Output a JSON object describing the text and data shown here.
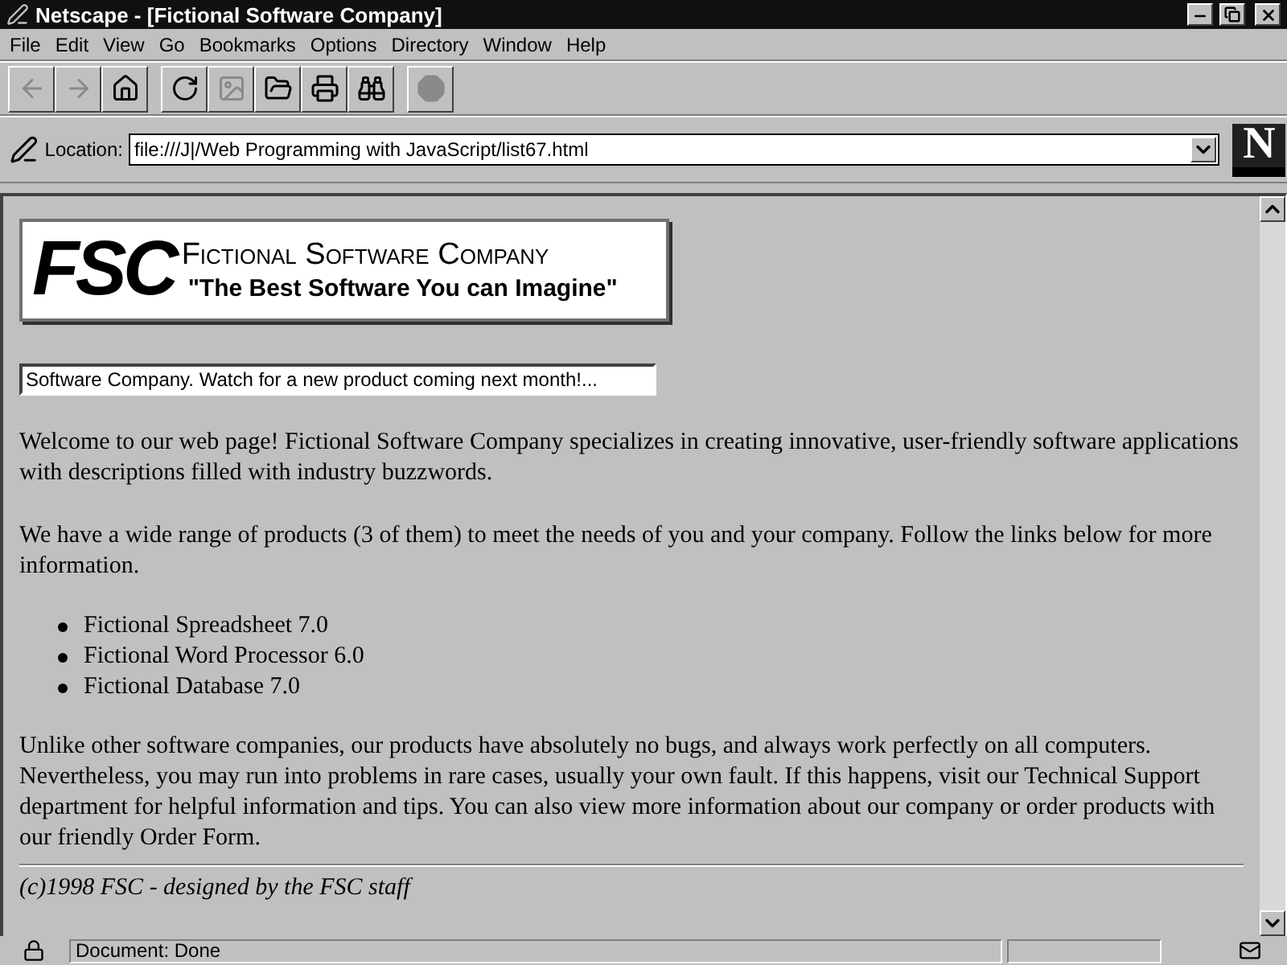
{
  "window": {
    "title": "Netscape - [Fictional Software Company]"
  },
  "menu": [
    "File",
    "Edit",
    "View",
    "Go",
    "Bookmarks",
    "Options",
    "Directory",
    "Window",
    "Help"
  ],
  "toolbar": [
    [
      {
        "kind": "back",
        "disabled": true
      },
      {
        "kind": "forward",
        "disabled": true
      },
      {
        "kind": "home",
        "disabled": false
      }
    ],
    [
      {
        "kind": "reload",
        "disabled": false
      },
      {
        "kind": "images",
        "disabled": true
      },
      {
        "kind": "open",
        "disabled": false
      },
      {
        "kind": "print",
        "disabled": false
      },
      {
        "kind": "find",
        "disabled": false
      }
    ],
    [
      {
        "kind": "stop",
        "disabled": true
      }
    ]
  ],
  "logo": {
    "letter": "N"
  },
  "location": {
    "label": "Location:",
    "value": "file:///J|/Web Programming with JavaScript/list67.html"
  },
  "page": {
    "logo": {
      "mark": "FSC",
      "name": "Fictional Software Company",
      "slogan": "\"The Best Software You can Imagine\""
    },
    "ticker": {
      "value": "Software Company. Watch for a new product coming next month!..."
    },
    "paragraphs": [
      "Welcome to our web page! Fictional Software Company specializes in creating innovative, user-friendly software applications with descriptions filled with industry buzzwords.",
      "We have a wide range of products (3 of them) to meet the needs of you and your company. Follow the links below for more information."
    ],
    "products": [
      "Fictional Spreadsheet 7.0",
      "Fictional Word Processor 6.0",
      "Fictional Database 7.0"
    ],
    "closing": "Unlike other software companies, our products have absolutely no bugs, and always work perfectly on all computers. Nevertheless, you may run into problems in rare cases, usually your own fault. If this happens, visit our Technical Support department for helpful information and tips. You can also view more information about our company or order products with our friendly Order Form.",
    "footer": "(c)1998 FSC - designed by the FSC staff"
  },
  "status": {
    "text": "Document: Done"
  }
}
